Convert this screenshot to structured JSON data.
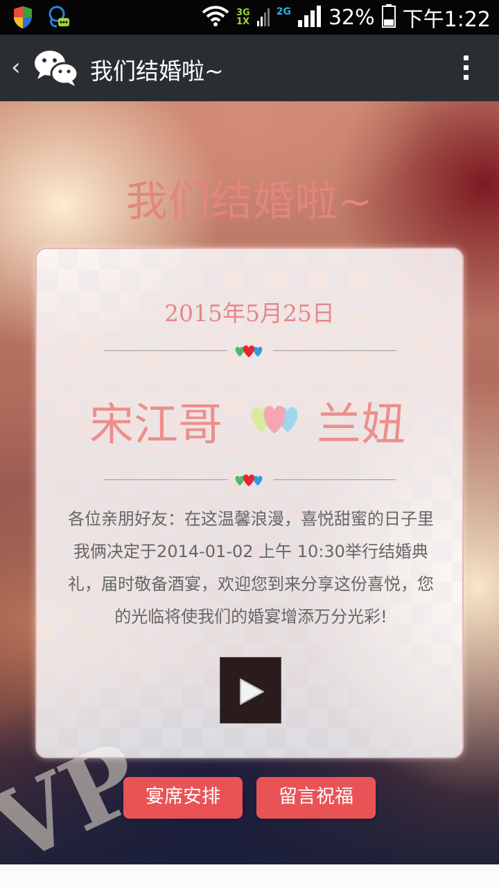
{
  "status_bar": {
    "net_3g": "3G",
    "net_1x": "1X",
    "net_2g": "2G",
    "battery": "32%",
    "time": "下午1:22",
    "icons": [
      "shield-icon",
      "qq-icon",
      "wifi-icon",
      "signal-icon",
      "battery-icon"
    ]
  },
  "action_bar": {
    "back": "‹",
    "title": "我们结婚啦~",
    "icons": [
      "back-arrow-icon",
      "wechat-icon",
      "overflow-menu-icon"
    ]
  },
  "invitation": {
    "hero_title": "我们结婚啦~",
    "date": "2015年5月25日",
    "groom": "宋江哥",
    "bride": "兰妞",
    "message": "各位亲朋好友：在这温馨浪漫，喜悦甜蜜的日子里我俩决定于2014-01-02 上午 10:30举行结婚典礼，届时敬备酒宴，欢迎您到来分享这份喜悦，您的光临将使我们的婚宴增添万分光彩!",
    "play_icon": "play-icon"
  },
  "buttons": {
    "banquet": "宴席安排",
    "blessing": "留言祝福"
  },
  "colors": {
    "accent": "#ea5356",
    "title_pink": "#e3857e",
    "name_pink": "#ec8f8d",
    "action_bar": "#2a2e33"
  }
}
